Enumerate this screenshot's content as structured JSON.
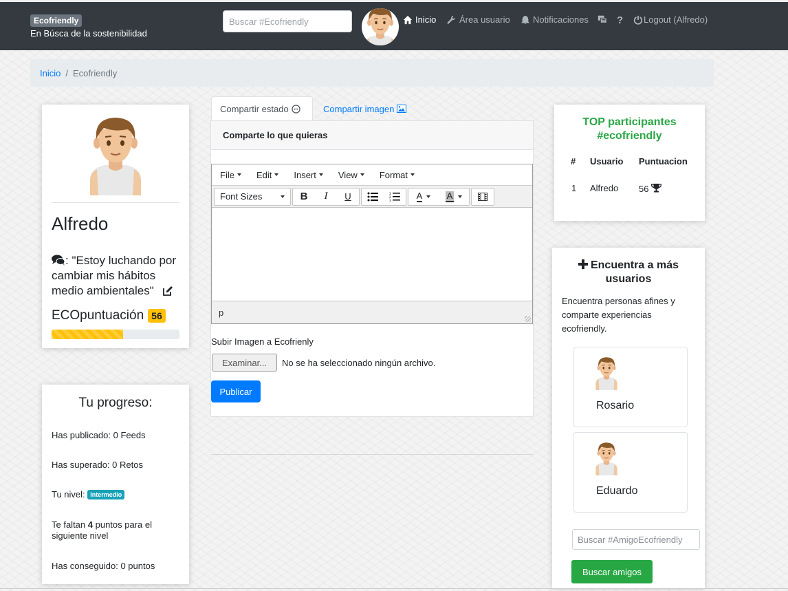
{
  "header": {
    "brand": "Ecofriendly",
    "tagline": "En Búsca de la sostenibilidad",
    "search_placeholder": "Buscar #Ecofriendly",
    "nav": {
      "inicio": "Inicio",
      "area_usuario": "Área usuario",
      "notificaciones": "Notificaciones",
      "help": "?",
      "logout": "Logout (Alfredo)"
    }
  },
  "breadcrumb": {
    "home": "Inicio",
    "separator": "/",
    "current": "Ecofriendly"
  },
  "profile": {
    "name": "Alfredo",
    "quote": ": \"Estoy luchando por cambiar mis hábitos medio ambientales\"",
    "eco_label": "ECOpuntuación",
    "eco_score": "56",
    "eco_progress_percent": 56
  },
  "progress_card": {
    "title": "Tu progreso:",
    "published": "Has publicado: 0 Feeds",
    "overcome": "Has superado: 0 Retos",
    "level_label": "Tu nivel:",
    "level": "Intermedio",
    "remaining_prefix": "Te faltan ",
    "remaining_points": "4",
    "remaining_suffix": " puntos para el siguiente nivel",
    "earned": "Has conseguido: 0 puntos"
  },
  "post": {
    "tabs": {
      "status": "Compartir estado",
      "image": "Compartir imagen"
    },
    "header": "Comparte lo que quieras",
    "menu": [
      "File",
      "Edit",
      "Insert",
      "View",
      "Format"
    ],
    "font_sizes": "Font Sizes",
    "statusbar_path": "p",
    "upload_label": "Subir Imagen a Ecofrienly",
    "file_button": "Examinar...",
    "file_status": "No se ha seleccionado ningún archivo.",
    "publish": "Publicar"
  },
  "top": {
    "title_line1": "TOP participantes",
    "title_line2": "#ecofriendly",
    "headers": {
      "rank": "#",
      "user": "Usuario",
      "score": "Puntuacion"
    },
    "rows": [
      {
        "rank": "1",
        "user": "Alfredo",
        "score": "56"
      }
    ]
  },
  "find": {
    "title_line1": "Encuentra a más",
    "title_line2": "usuarios",
    "description": "Encuentra personas afines y comparte experiencias ecofriendly.",
    "users": [
      "Rosario",
      "Eduardo"
    ],
    "search_placeholder": "Buscar #AmigoEcofriendly",
    "button": "Buscar amigos"
  },
  "colors": {
    "navbar": "#343a40",
    "primary": "#007bff",
    "success": "#28a745",
    "warning": "#ffc107",
    "info": "#17a2b8"
  }
}
